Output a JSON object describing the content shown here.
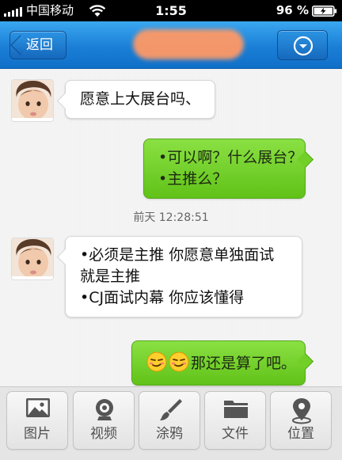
{
  "status_bar": {
    "carrier": "中国移动",
    "time": "1:55",
    "battery": "96 %"
  },
  "nav": {
    "back_label": "返回"
  },
  "messages": {
    "m1": {
      "line1": "愿意上大展台吗、"
    },
    "m2": {
      "line1": "•可以啊？什么展台？",
      "line2": "•主推么？"
    },
    "timestamp": "前天 12:28:51",
    "m3": {
      "line1": "•必须是主推 你愿意单独面试",
      "line2": "就是主推",
      "line3": "•CJ面试内幕 你应该懂得"
    },
    "m4": {
      "line1": "那还是算了吧。"
    }
  },
  "toolbar": {
    "items": [
      {
        "label": "图片",
        "icon": "image-icon"
      },
      {
        "label": "视频",
        "icon": "webcam-icon"
      },
      {
        "label": "涂鸦",
        "icon": "brush-icon"
      },
      {
        "label": "文件",
        "icon": "folder-icon"
      },
      {
        "label": "位置",
        "icon": "location-pin-icon"
      }
    ]
  },
  "colors": {
    "nav_blue": "#1b7fd6",
    "bubble_green": "#6ccb22",
    "bubble_white": "#ffffff"
  }
}
